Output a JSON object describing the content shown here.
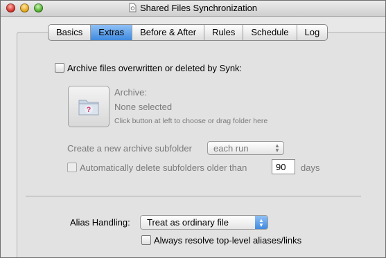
{
  "window": {
    "title": "Shared Files Synchronization"
  },
  "tabs": [
    {
      "label": "Basics",
      "active": false
    },
    {
      "label": "Extras",
      "active": true
    },
    {
      "label": "Before & After",
      "active": false
    },
    {
      "label": "Rules",
      "active": false
    },
    {
      "label": "Schedule",
      "active": false
    },
    {
      "label": "Log",
      "active": false
    }
  ],
  "archive": {
    "checkbox_label": "Archive files overwritten or deleted by Synk:",
    "checked": false,
    "heading": "Archive:",
    "selection": "None selected",
    "hint": "Click button at left to choose or drag folder here",
    "subfolder_label": "Create a new archive subfolder",
    "subfolder_value": "each run",
    "auto_delete_label": "Automatically delete subfolders older than",
    "auto_delete_days": "90",
    "days_label": "days"
  },
  "alias": {
    "label": "Alias Handling:",
    "value": "Treat as ordinary file",
    "resolve_label": "Always resolve top-level aliases/links",
    "resolve_checked": false
  },
  "icons": {
    "close": "close-icon",
    "minimize": "minimize-icon",
    "zoom": "zoom-icon",
    "document": "document-icon",
    "folder": "folder-question-icon"
  },
  "colors": {
    "accent": "#3f8ae0"
  }
}
